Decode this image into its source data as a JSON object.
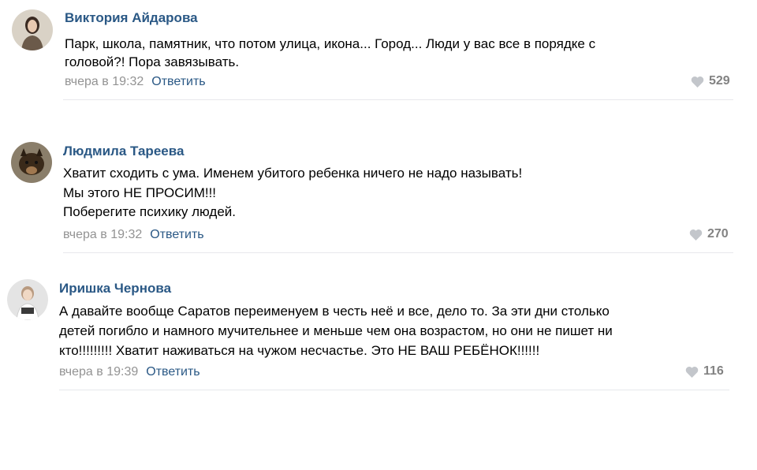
{
  "comments": [
    {
      "author": "Виктория Айдарова",
      "lines": [
        "Парк, школа, памятник, что потом улица, икона... Город... Люди у вас все в порядке с",
        "головой?! Пора завязывать."
      ],
      "time": "вчера в 19:32",
      "reply_label": "Ответить",
      "likes": "529"
    },
    {
      "author": "Людмила Тареева",
      "lines": [
        "Хватит сходить с ума. Именем убитого ребенка ничего не надо называть!",
        "Мы этого НЕ ПРОСИМ!!!",
        "Поберегите психику людей."
      ],
      "time": "вчера в 19:32",
      "reply_label": "Ответить",
      "likes": "270"
    },
    {
      "author": "Иришка Чернова",
      "lines": [
        "А давайте вообще Саратов переименуем в честь неё и все, дело то. За эти дни столько",
        "детей погибло и намного мучительнее и меньше чем она возрастом, но они не пишет ни",
        "кто!!!!!!!!! Хватит наживаться на чужом несчастье. Это НЕ ВАШ РЕБЁНОК!!!!!!"
      ],
      "time": "вчера в 19:39",
      "reply_label": "Ответить",
      "likes": "116"
    }
  ],
  "icons": {
    "like": "heart-icon"
  },
  "colors": {
    "author": "#2a5885",
    "time": "#939393",
    "likes": "#828282",
    "divider": "#e7e8ec"
  }
}
